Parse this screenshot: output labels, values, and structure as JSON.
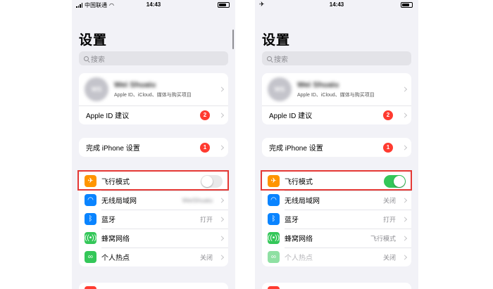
{
  "left": {
    "status": {
      "carrier": "中国联通",
      "time": "14:43"
    },
    "title": "设置",
    "search": {
      "placeholder": "搜索"
    },
    "profile": {
      "name": "Wei Shuaiu",
      "initials": "WS",
      "subtitle": "Apple ID、iCloud、媒体与购买项目"
    },
    "apple_id_suggestion": {
      "label": "Apple ID 建议",
      "badge": "2"
    },
    "finish_setup": {
      "label": "完成 iPhone 设置",
      "badge": "1"
    },
    "items": [
      {
        "label": "飞行模式",
        "icon": "airplane-icon",
        "toggle": "off"
      },
      {
        "label": "无线局域网",
        "icon": "wifi-icon",
        "value": "WeiShuaiu"
      },
      {
        "label": "蓝牙",
        "icon": "bluetooth-icon",
        "value": "打开"
      },
      {
        "label": "蜂窝网络",
        "icon": "cellular-icon",
        "value": ""
      },
      {
        "label": "个人热点",
        "icon": "hotspot-icon",
        "value": "关闭"
      }
    ]
  },
  "right": {
    "status": {
      "time": "14:43"
    },
    "title": "设置",
    "search": {
      "placeholder": "搜索"
    },
    "profile": {
      "name": "Wei Shuaiu",
      "initials": "WS",
      "subtitle": "Apple ID、iCloud、媒体与购买项目"
    },
    "apple_id_suggestion": {
      "label": "Apple ID 建议",
      "badge": "2"
    },
    "finish_setup": {
      "label": "完成 iPhone 设置",
      "badge": "1"
    },
    "items": [
      {
        "label": "飞行模式",
        "icon": "airplane-icon",
        "toggle": "on"
      },
      {
        "label": "无线局域网",
        "icon": "wifi-icon",
        "value": "关闭"
      },
      {
        "label": "蓝牙",
        "icon": "bluetooth-icon",
        "value": "打开"
      },
      {
        "label": "蜂窝网络",
        "icon": "cellular-icon",
        "value": "飞行模式"
      },
      {
        "label": "个人热点",
        "icon": "hotspot-icon",
        "value": "关闭"
      }
    ]
  },
  "colors": {
    "highlight_border": "#e53935",
    "toggle_on": "#34c759",
    "badge": "#ff3b30",
    "airplane_tile": "#ff9500",
    "wifi_tile": "#0a84ff",
    "cellular_tile": "#34c759"
  }
}
